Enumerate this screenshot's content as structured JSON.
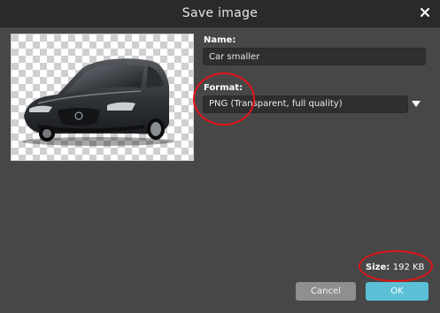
{
  "dialog": {
    "title": "Save image"
  },
  "name": {
    "label": "Name:",
    "value": "Car smaller"
  },
  "format": {
    "label": "Format:",
    "selected": "PNG (Transparent, full quality)"
  },
  "size": {
    "label": "Size:",
    "value": "192 KB"
  },
  "buttons": {
    "cancel": "Cancel",
    "ok": "OK"
  },
  "icons": {
    "close": "close-icon",
    "dropdown": "chevron-down-icon"
  },
  "colors": {
    "accent": "#5bc0d6",
    "annotation": "#e2131a",
    "background": "#474747"
  }
}
